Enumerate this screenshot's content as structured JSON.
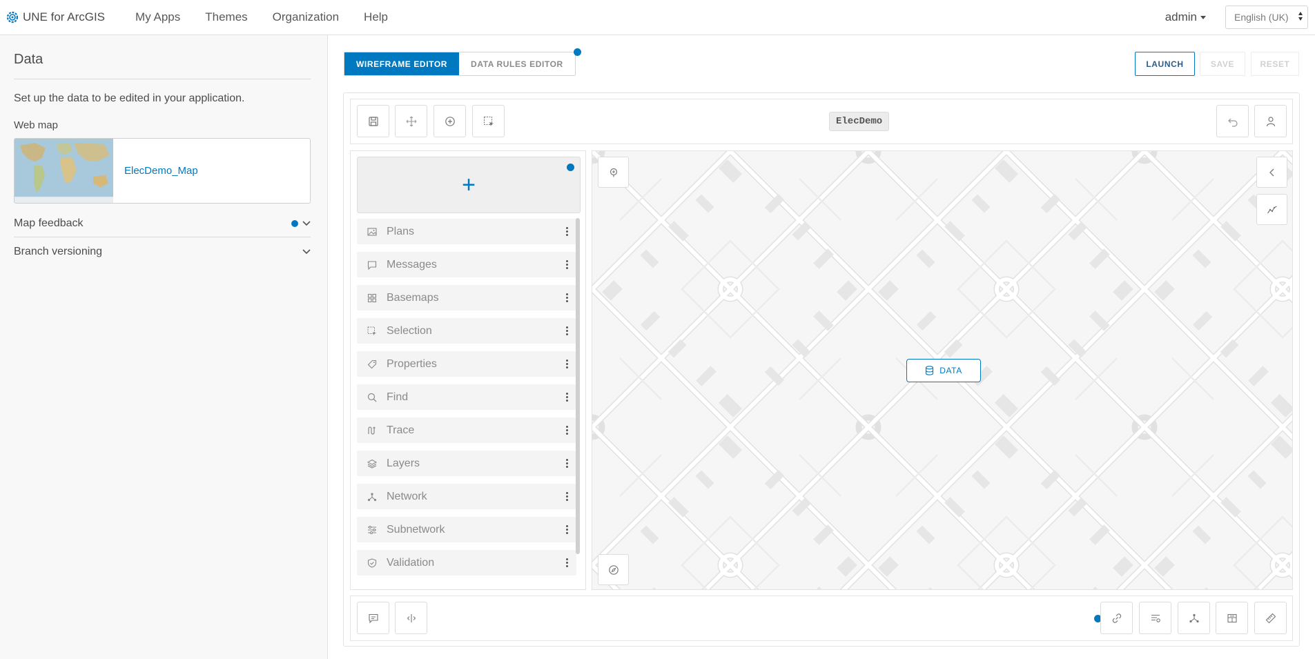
{
  "brand": {
    "title": "UNE for ArcGIS",
    "logo_icon": "gear-logo-icon"
  },
  "nav": {
    "items": [
      "My Apps",
      "Themes",
      "Organization",
      "Help"
    ]
  },
  "user": {
    "name": "admin"
  },
  "language": {
    "selected": "English (UK)"
  },
  "left_panel": {
    "title": "Data",
    "description": "Set up the data to be edited in your application.",
    "webmap_label": "Web map",
    "webmap_name": "ElecDemo_Map",
    "sections": [
      {
        "label": "Map feedback",
        "has_dot": true
      },
      {
        "label": "Branch versioning",
        "has_dot": false
      }
    ]
  },
  "editor": {
    "tabs": [
      {
        "label": "WIREFRAME EDITOR",
        "active": true
      },
      {
        "label": "DATA RULES EDITOR",
        "active": false
      }
    ],
    "actions": {
      "launch": "LAUNCH",
      "save": "SAVE",
      "reset": "RESET"
    },
    "app_name": "ElecDemo",
    "widgets": [
      {
        "label": "Plans",
        "icon": "image-icon"
      },
      {
        "label": "Messages",
        "icon": "message-icon"
      },
      {
        "label": "Basemaps",
        "icon": "grid-icon"
      },
      {
        "label": "Selection",
        "icon": "selection-icon"
      },
      {
        "label": "Properties",
        "icon": "tag-icon"
      },
      {
        "label": "Find",
        "icon": "search-icon"
      },
      {
        "label": "Trace",
        "icon": "trace-icon"
      },
      {
        "label": "Layers",
        "icon": "layers-icon"
      },
      {
        "label": "Network",
        "icon": "network-icon"
      },
      {
        "label": "Subnetwork",
        "icon": "subnetwork-icon"
      },
      {
        "label": "Validation",
        "icon": "shield-check-icon"
      }
    ],
    "map_badge": "DATA"
  },
  "colors": {
    "accent": "#0079c1",
    "panel_bg": "#f8f8f8",
    "map_bg": "#f6f6f6"
  }
}
